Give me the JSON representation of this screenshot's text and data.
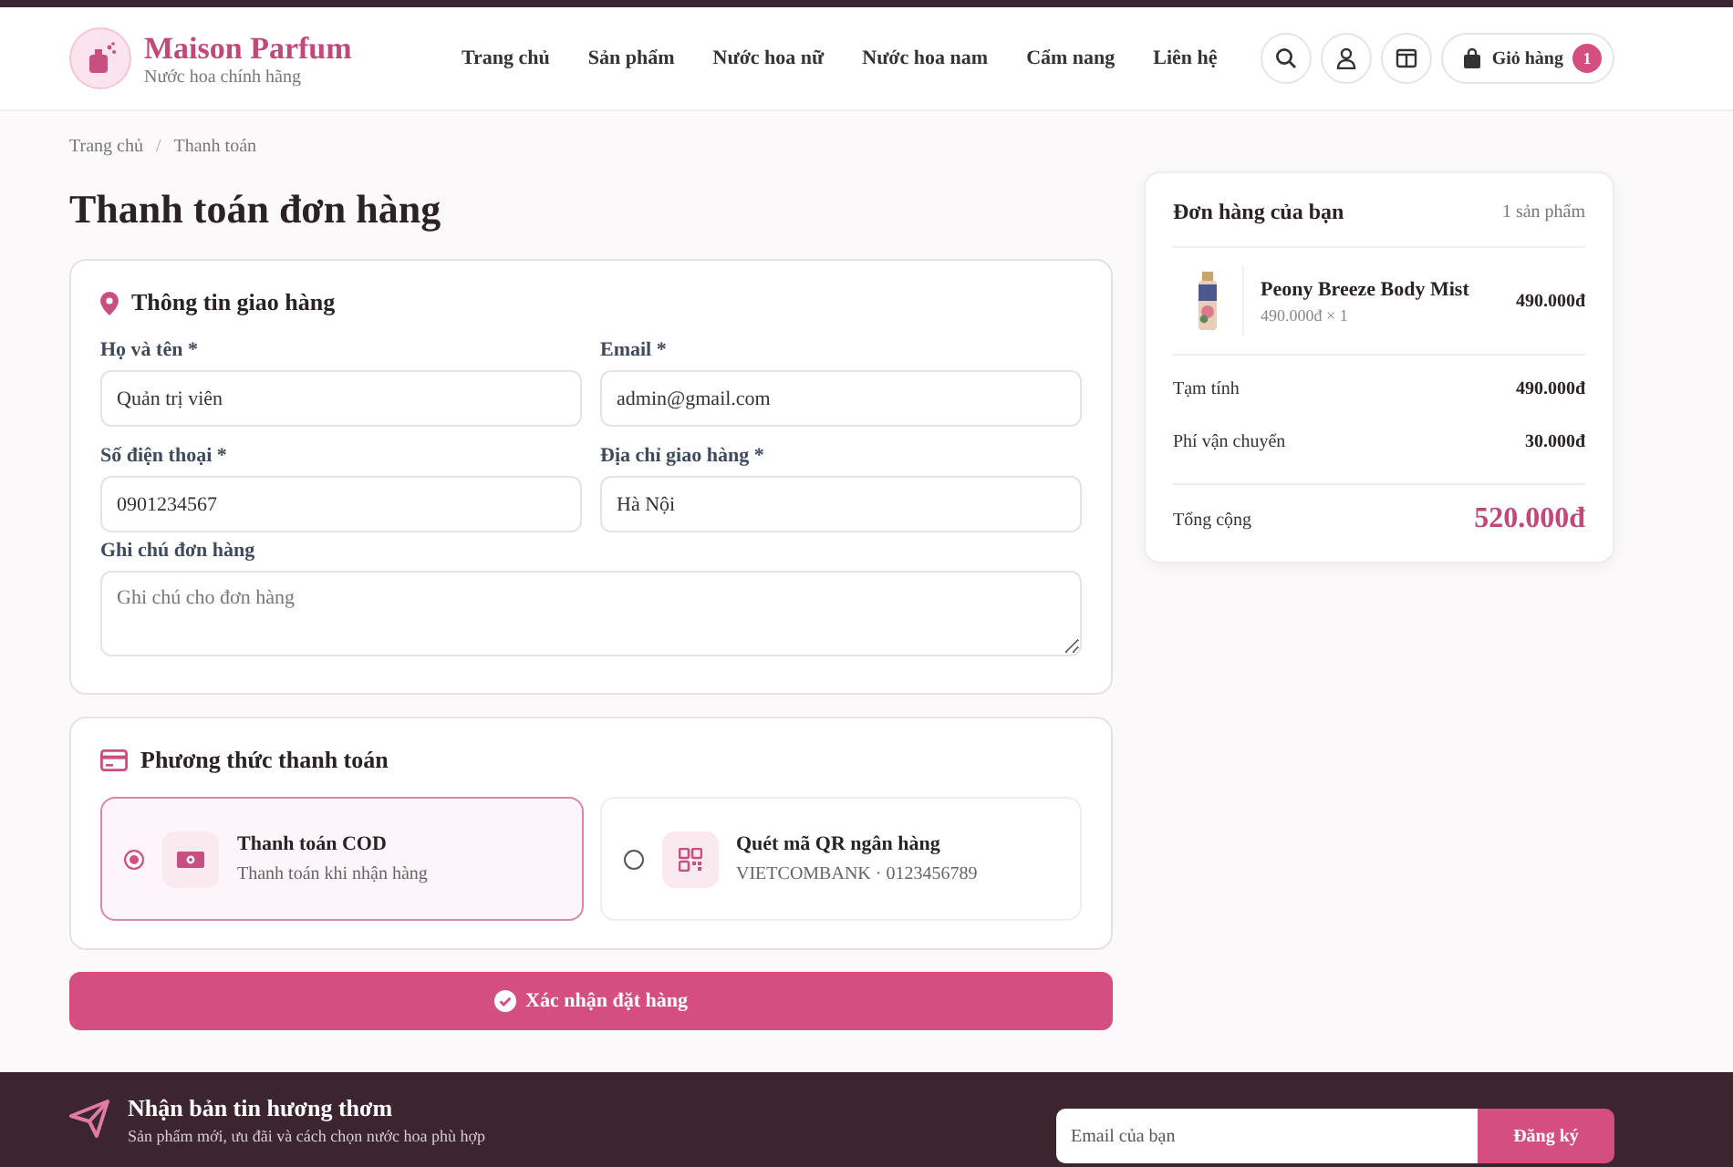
{
  "header": {
    "brand": "Maison Parfum",
    "tagline": "Nước hoa chính hãng",
    "nav": [
      {
        "label": "Trang chủ"
      },
      {
        "label": "Sản phẩm"
      },
      {
        "label": "Nước hoa nữ"
      },
      {
        "label": "Nước hoa nam"
      },
      {
        "label": "Cẩm nang"
      },
      {
        "label": "Liên hệ"
      }
    ],
    "cart": {
      "label": "Giỏ hàng",
      "count": "1"
    }
  },
  "breadcrumb": [
    "Trang chủ",
    "Thanh toán"
  ],
  "breadcrumb_separator": "/",
  "title": "Thanh toán đơn hàng",
  "shipping": {
    "heading": "Thông tin giao hàng",
    "fields": [
      {
        "label": "Họ và tên *",
        "value": "Quản trị viên"
      },
      {
        "label": "Email *",
        "value": "admin@gmail.com"
      },
      {
        "label": "Số điện thoại *",
        "value": "0901234567"
      },
      {
        "label": "Địa chỉ giao hàng *",
        "value": "Hà Nội"
      }
    ],
    "note": {
      "label": "Ghi chú đơn hàng",
      "placeholder": "Ghi chú cho đơn hàng"
    }
  },
  "payment": {
    "heading": "Phương thức thanh toán",
    "methods": [
      {
        "kind": "cash",
        "title": "Thanh toán COD",
        "subtitle": "Thanh toán khi nhận hàng",
        "selected": true
      },
      {
        "kind": "qr",
        "title": "Quét mã QR ngân hàng",
        "subtitle": "VIETCOMBANK · 0123456789",
        "selected": false
      }
    ]
  },
  "submit": "Xác nhận đặt hàng",
  "summary": {
    "heading": "Đơn hàng của bạn",
    "count": "1 sản phẩm",
    "items": [
      {
        "kind": "picture",
        "name": "Peony Breeze Body Mist",
        "qty": "490.000đ × 1",
        "price": "490.000đ"
      }
    ],
    "lines": [
      {
        "label": "Tạm tính",
        "value": "490.000đ"
      },
      {
        "label": "Phí vận chuyển",
        "value": "30.000đ"
      }
    ],
    "total": {
      "label": "Tổng cộng",
      "value": "520.000đ"
    }
  },
  "newsletter": {
    "heading": "Nhận bản tin hương thơm",
    "text": "Sản phẩm mới, ưu đãi và cách chọn nước hoa phù hợp",
    "placeholder": "Email của bạn",
    "button": "Đăng ký"
  }
}
